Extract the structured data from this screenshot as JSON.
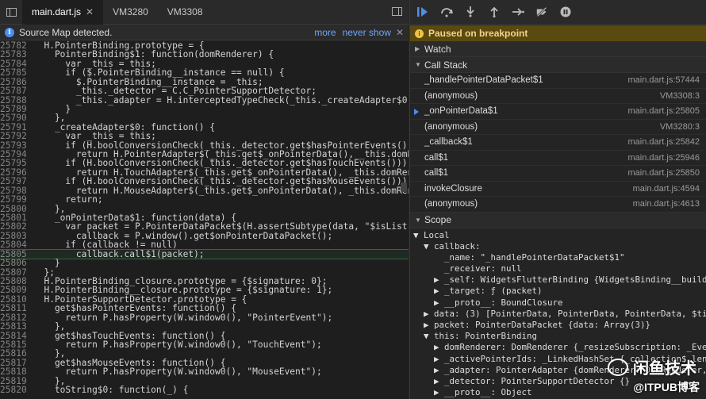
{
  "editor": {
    "tabs": [
      {
        "label": "main.dart.js",
        "active": true
      },
      {
        "label": "VM3280"
      },
      {
        "label": "VM3308"
      }
    ],
    "infobar": {
      "text": "Source Map detected.",
      "more": "more",
      "never_show": "never show"
    },
    "lines": [
      {
        "n": "25782",
        "c": "  H.PointerBinding.prototype = {"
      },
      {
        "n": "25783",
        "c": "    PointerBinding$1: function(domRenderer) {"
      },
      {
        "n": "25784",
        "c": "      var _this = this;"
      },
      {
        "n": "25785",
        "c": "      if ($.PointerBinding__instance == null) {"
      },
      {
        "n": "25786",
        "c": "        $.PointerBinding__instance = _this;"
      },
      {
        "n": "25787",
        "c": "        _this._detector = C.C_PointerSupportDetector;"
      },
      {
        "n": "25788",
        "c": "        _this._adapter = H.interceptedTypeCheck(_this._createAdapter$0(), \"$isBas"
      },
      {
        "n": "25789",
        "c": "      }"
      },
      {
        "n": "25790",
        "c": "    },"
      },
      {
        "n": "25791",
        "c": "    _createAdapter$0: function() {"
      },
      {
        "n": "25792",
        "c": "      var _this = this;"
      },
      {
        "n": "25793",
        "c": "      if (H.boolConversionCheck(_this._detector.get$hasPointerEvents()))"
      },
      {
        "n": "25794",
        "c": "        return H.PointerAdapter$(_this.get$_onPointerData(), _this.domRenderer);"
      },
      {
        "n": "25795",
        "c": "      if (H.boolConversionCheck(_this._detector.get$hasTouchEvents()))"
      },
      {
        "n": "25796",
        "c": "        return H.TouchAdapter$(_this.get$_onPointerData(), _this.domRenderer);"
      },
      {
        "n": "25797",
        "c": "      if (H.boolConversionCheck(_this._detector.get$hasMouseEvents()))"
      },
      {
        "n": "25798",
        "c": "        return H.MouseAdapter$(_this.get$_onPointerData(), _this.domRenderer);"
      },
      {
        "n": "25799",
        "c": "      return;"
      },
      {
        "n": "25800",
        "c": "    },"
      },
      {
        "n": "25801",
        "c": "    _onPointerData$1: function(data) {"
      },
      {
        "n": "25802",
        "c": "      var packet = P.PointerDataPacket$(H.assertSubtype(data, \"$isList\", [P.Point"
      },
      {
        "n": "25803",
        "c": "        callback = P.window().get$onPointerDataPacket();"
      },
      {
        "n": "25804",
        "c": "      if (callback != null)"
      },
      {
        "n": "25805",
        "c": "        callback.call$1(packet);",
        "hl": true
      },
      {
        "n": "25806",
        "c": "    }"
      },
      {
        "n": "25807",
        "c": "  };"
      },
      {
        "n": "25808",
        "c": "  H.PointerBinding_closure.prototype = {$signature: 0};"
      },
      {
        "n": "25809",
        "c": "  H.PointerBinding__closure.prototype = {$signature: 1};"
      },
      {
        "n": "25810",
        "c": "  H.PointerSupportDetector.prototype = {"
      },
      {
        "n": "25811",
        "c": "    get$hasPointerEvents: function() {"
      },
      {
        "n": "25812",
        "c": "      return P.hasProperty(W.window0(), \"PointerEvent\");"
      },
      {
        "n": "25813",
        "c": "    },"
      },
      {
        "n": "25814",
        "c": "    get$hasTouchEvents: function() {"
      },
      {
        "n": "25815",
        "c": "      return P.hasProperty(W.window0(), \"TouchEvent\");"
      },
      {
        "n": "25816",
        "c": "    },"
      },
      {
        "n": "25817",
        "c": "    get$hasMouseEvents: function() {"
      },
      {
        "n": "25818",
        "c": "      return P.hasProperty(W.window0(), \"MouseEvent\");"
      },
      {
        "n": "25819",
        "c": "    },"
      },
      {
        "n": "25820",
        "c": "    toString$0: function(_) {"
      }
    ]
  },
  "debugger": {
    "paused_text": "Paused on breakpoint",
    "watch_label": "Watch",
    "callstack_label": "Call Stack",
    "frames": [
      {
        "fn": "_handlePointerDataPacket$1",
        "loc": "main.dart.js:57444"
      },
      {
        "fn": "(anonymous)",
        "loc": "VM3308:3"
      },
      {
        "fn": "_onPointerData$1",
        "loc": "main.dart.js:25805",
        "current": true
      },
      {
        "fn": "(anonymous)",
        "loc": "VM3280:3"
      },
      {
        "fn": "_callback$1",
        "loc": "main.dart.js:25842"
      },
      {
        "fn": "call$1",
        "loc": "main.dart.js:25946"
      },
      {
        "fn": "call$1",
        "loc": "main.dart.js:25850"
      },
      {
        "fn": "invokeClosure",
        "loc": "main.dart.js:4594"
      },
      {
        "fn": "(anonymous)",
        "loc": "main.dart.js:4613"
      }
    ],
    "scope_label": "Scope",
    "scope_lines": [
      "▼ Local",
      "  ▼ callback:",
      "      _name: \"_handlePointerDataPacket$1\"",
      "      _receiver: null",
      "    ▶ _self: WidgetsFlutterBinding {WidgetsBinding__buildOwne…",
      "    ▶ _target: ƒ (packet)",
      "    ▶ __proto__: BoundClosure",
      "  ▶ data: (3) [PointerData, PointerData, PointerData, $ti: Ar…",
      "  ▶ packet: PointerDataPacket {data: Array(3)}",
      "  ▼ this: PointerBinding",
      "    ▶ domRenderer: DomRenderer {_resizeSubscription: _EventSt…",
      "    ▶ _activePointerIds: _LinkedHashSet {_collection$_length:…",
      "    ▶ _adapter: PointerAdapter {domRenderer: DomRenderer, _ca…",
      "    ▶ _detector: PointerSupportDetector {}",
      "    ▶ __proto__: Object"
    ]
  },
  "watermark": {
    "line1": "闲鱼技术",
    "line2": "@ITPUB博客"
  }
}
